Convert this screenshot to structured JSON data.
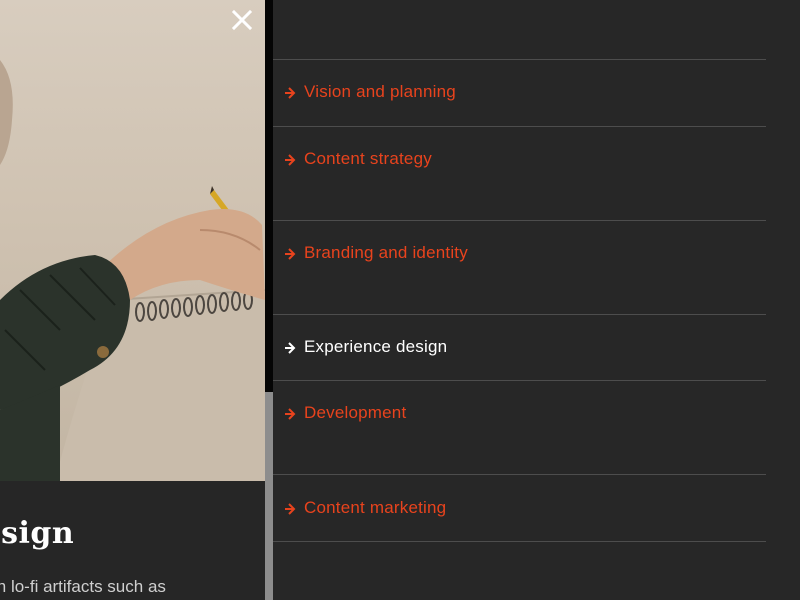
{
  "colors": {
    "accent": "#e8431d",
    "active": "#ffffff",
    "background": "#272727"
  },
  "left_panel": {
    "close_icon": "close-icon",
    "caption_title": "design",
    "caption_text": "with lo-fi artifacts such as"
  },
  "menu": {
    "items": [
      {
        "label": "Vision and planning",
        "state": "default",
        "icon": "arrow-right-icon"
      },
      {
        "label": "Content strategy",
        "state": "default",
        "icon": "arrow-right-icon"
      },
      {
        "label": "Branding and identity",
        "state": "default",
        "icon": "arrow-right-icon"
      },
      {
        "label": "Experience design",
        "state": "active",
        "icon": "arrow-right-icon"
      },
      {
        "label": "Development",
        "state": "default",
        "icon": "arrow-right-icon"
      },
      {
        "label": "Content marketing",
        "state": "default",
        "icon": "arrow-right-icon"
      }
    ]
  }
}
